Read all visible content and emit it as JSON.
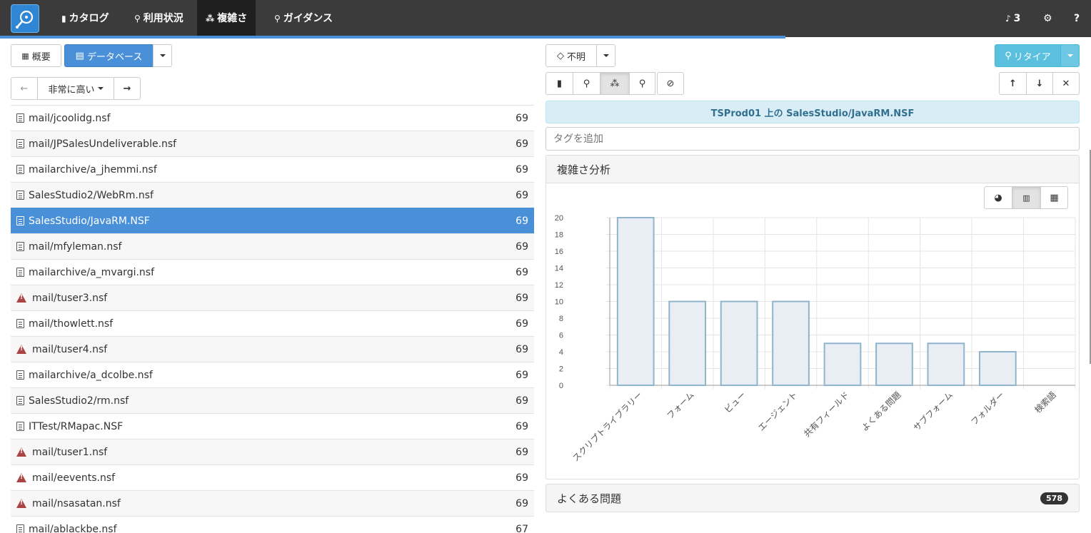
{
  "nav": {
    "items": [
      {
        "label": "カタログ",
        "icon": "book-icon"
      },
      {
        "label": "利用状況",
        "icon": "search-icon"
      },
      {
        "label": "複雑さ",
        "icon": "cubes-icon"
      },
      {
        "label": "ガイダンス",
        "icon": "map-marker-icon"
      }
    ],
    "notifications": "3"
  },
  "left": {
    "overview_label": "概要",
    "database_label": "データベース",
    "sort_label": "非常に高い"
  },
  "rows": [
    {
      "name": "mail/jcoolidg.nsf",
      "count": "69",
      "icon": "doc"
    },
    {
      "name": "mail/JPSalesUndeliverable.nsf",
      "count": "69",
      "icon": "doc"
    },
    {
      "name": "mailarchive/a_jhemmi.nsf",
      "count": "69",
      "icon": "doc"
    },
    {
      "name": "SalesStudio2/WebRm.nsf",
      "count": "69",
      "icon": "doc"
    },
    {
      "name": "SalesStudio/JavaRM.NSF",
      "count": "69",
      "icon": "doc",
      "selected": true
    },
    {
      "name": "mail/mfyleman.nsf",
      "count": "69",
      "icon": "doc"
    },
    {
      "name": "mailarchive/a_mvargi.nsf",
      "count": "69",
      "icon": "doc"
    },
    {
      "name": "mail/tuser3.nsf",
      "count": "69",
      "icon": "warn"
    },
    {
      "name": "mail/thowlett.nsf",
      "count": "69",
      "icon": "doc"
    },
    {
      "name": "mail/tuser4.nsf",
      "count": "69",
      "icon": "warn"
    },
    {
      "name": "mailarchive/a_dcolbe.nsf",
      "count": "69",
      "icon": "doc"
    },
    {
      "name": "SalesStudio2/rm.nsf",
      "count": "69",
      "icon": "doc"
    },
    {
      "name": "ITTest/RMapac.NSF",
      "count": "69",
      "icon": "doc"
    },
    {
      "name": "mail/tuser1.nsf",
      "count": "69",
      "icon": "warn"
    },
    {
      "name": "mail/eevents.nsf",
      "count": "69",
      "icon": "warn"
    },
    {
      "name": "mail/nsasatan.nsf",
      "count": "69",
      "icon": "warn"
    },
    {
      "name": "mail/ablackbe.nsf",
      "count": "67",
      "icon": "doc"
    }
  ],
  "right": {
    "unknown_label": "不明",
    "retire_label": "リタイア",
    "info_text": "TSProd01 上の SalesStudio/JavaRM.NSF",
    "tag_placeholder": "タグを追加",
    "complexity_title": "複雑さ分析",
    "faq_title": "よくある問題",
    "faq_count": "578"
  },
  "chart_data": {
    "type": "bar",
    "categories": [
      "スクリプトライブラリー",
      "フォーム",
      "ビュー",
      "エージェント",
      "共有フィールド",
      "よくある問題",
      "サブフォーム",
      "フォルダー",
      "検索語"
    ],
    "values": [
      20,
      10,
      10,
      10,
      5,
      5,
      5,
      4,
      0
    ],
    "ylim": [
      0,
      20
    ],
    "yticks": [
      0,
      2,
      4,
      6,
      8,
      10,
      12,
      14,
      16,
      18,
      20
    ],
    "grid": true,
    "colors": {
      "fill": "#e8eef4",
      "stroke": "#8fb4cc"
    }
  }
}
